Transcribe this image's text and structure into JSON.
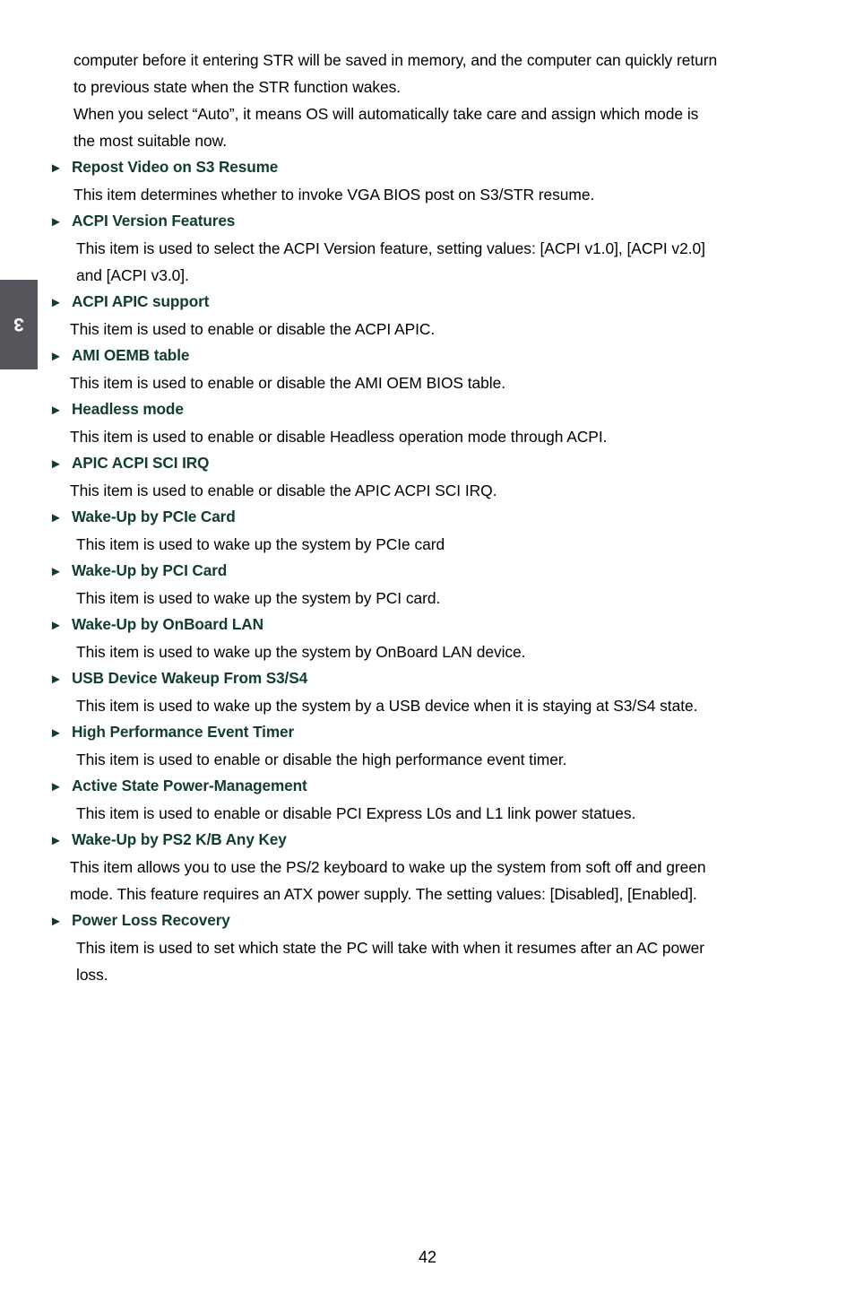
{
  "chapter_tab": {
    "number": "3",
    "background_color": "#54565b",
    "text_color": "#ffffff"
  },
  "colors": {
    "heading_green": "#103d2d",
    "body_black": "#000000",
    "page_background": "#ffffff"
  },
  "intro_paragraph": {
    "lines": [
      "computer before it entering STR will be saved in memory, and the computer can quickly return",
      "to previous state when the STR function wakes.",
      "When you select “Auto”, it means OS will automatically take care and assign which mode is",
      "the most suitable now."
    ]
  },
  "bullet_glyph": "►",
  "items": [
    {
      "title": "Repost Video on S3 Resume",
      "body_lines": [
        "This item determines whether to invoke VGA BIOS post on S3/STR resume."
      ]
    },
    {
      "title": "ACPI Version Features",
      "body_lines": [
        "This item is used to select the ACPI Version feature, setting values: [ACPI v1.0], [ACPI v2.0]",
        "and [ACPI v3.0]."
      ]
    },
    {
      "title": "ACPI APIC support",
      "body_lines": [
        "This item is used to enable or disable the ACPI APIC."
      ]
    },
    {
      "title": "AMI OEMB table",
      "body_lines": [
        "This item is used to enable or disable the AMI OEM BIOS table."
      ]
    },
    {
      "title": "Headless mode",
      "body_lines": [
        "This item is used to enable or disable Headless operation mode through ACPI."
      ]
    },
    {
      "title": "APIC ACPI SCI IRQ",
      "body_lines": [
        "This item is used to enable or disable the APIC ACPI SCI IRQ."
      ]
    },
    {
      "title": "Wake-Up by PCIe Card",
      "body_lines": [
        "This item is used to wake up the system by PCIe card"
      ]
    },
    {
      "title": "Wake-Up by PCI Card",
      "body_lines": [
        "This item is used to wake up the system by PCI card."
      ]
    },
    {
      "title": "Wake-Up by OnBoard LAN",
      "body_lines": [
        "This item is used to wake up the system by OnBoard LAN device."
      ]
    },
    {
      "title": "USB Device Wakeup From S3/S4",
      "body_lines": [
        "This item is used to wake up the system by a USB device when it  is staying at S3/S4 state."
      ]
    },
    {
      "title": "High Performance Event Timer",
      "body_lines": [
        "This item is used to enable or disable the high performance event timer."
      ]
    },
    {
      "title": "Active State Power-Management",
      "body_lines": [
        "This item is used to enable or disable PCI Express L0s and L1 link power statues."
      ]
    },
    {
      "title": "Wake-Up by PS2 K/B Any Key",
      "body_lines": [
        "This item allows you to use the PS/2 keyboard to wake up the system from soft off and green",
        "mode. This feature requires an ATX power supply. The setting values: [Disabled], [Enabled]."
      ]
    },
    {
      "title": "Power Loss Recovery",
      "body_lines": [
        "This item is used to set which state the PC will take with when it resumes after an AC power",
        "loss."
      ]
    }
  ],
  "footer": {
    "page_number": "42"
  }
}
